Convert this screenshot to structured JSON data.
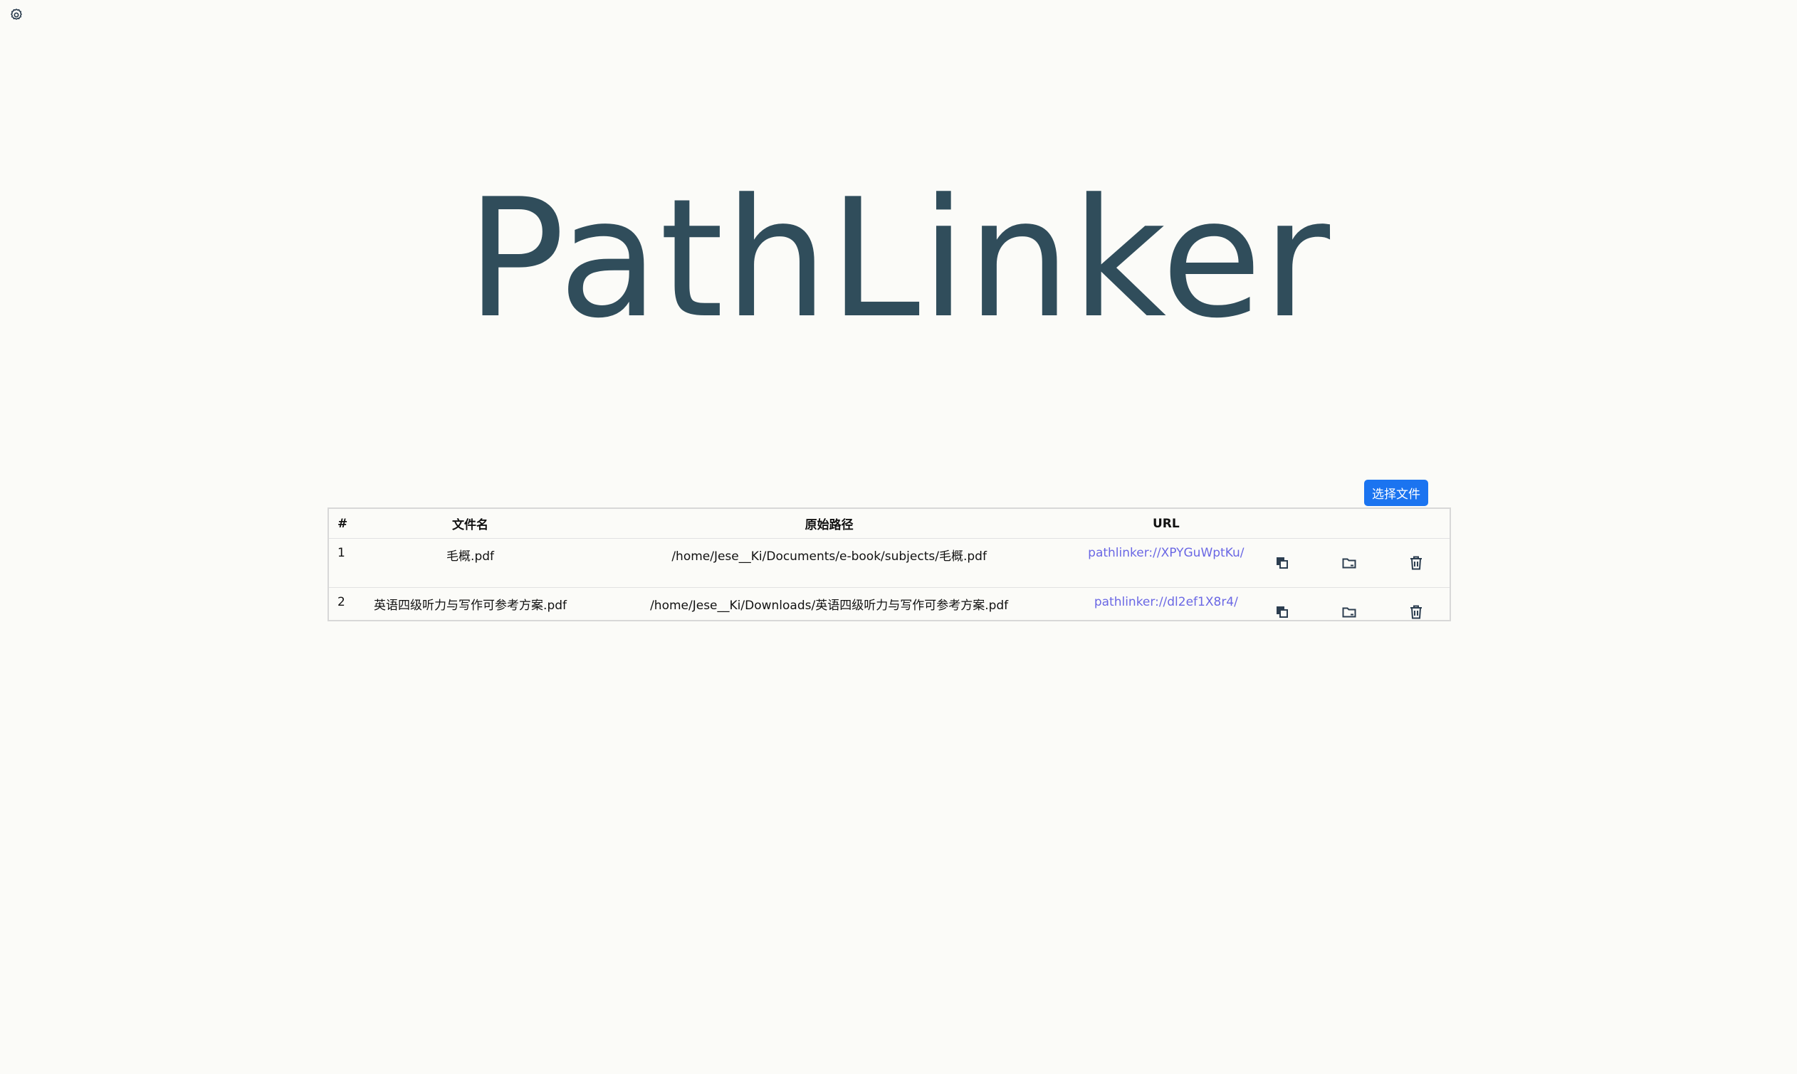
{
  "app": {
    "title": "PathLinker"
  },
  "toolbar": {
    "select_file_label": "选择文件"
  },
  "table": {
    "headers": {
      "index": "#",
      "filename": "文件名",
      "path": "原始路径",
      "url": "URL"
    },
    "rows": [
      {
        "index": "1",
        "filename": "毛概.pdf",
        "path": "/home/Jese__Ki/Documents/e-book/subjects/毛概.pdf",
        "url": "pathlinker://XPYGuWptKu/"
      },
      {
        "index": "2",
        "filename": "英语四级听力与写作可参考方案.pdf",
        "path": "/home/Jese__Ki/Downloads/英语四级听力与写作可参考方案.pdf",
        "url": "pathlinker://dl2ef1X8r4/"
      }
    ]
  },
  "icons": {
    "settings": "gear-icon",
    "copy": "copy-icon",
    "open_folder": "folder-icon",
    "delete": "trash-icon"
  },
  "colors": {
    "background": "#fbfbf8",
    "title": "#304d5b",
    "accent_button": "#1b74f0",
    "link": "#6a67e4"
  }
}
